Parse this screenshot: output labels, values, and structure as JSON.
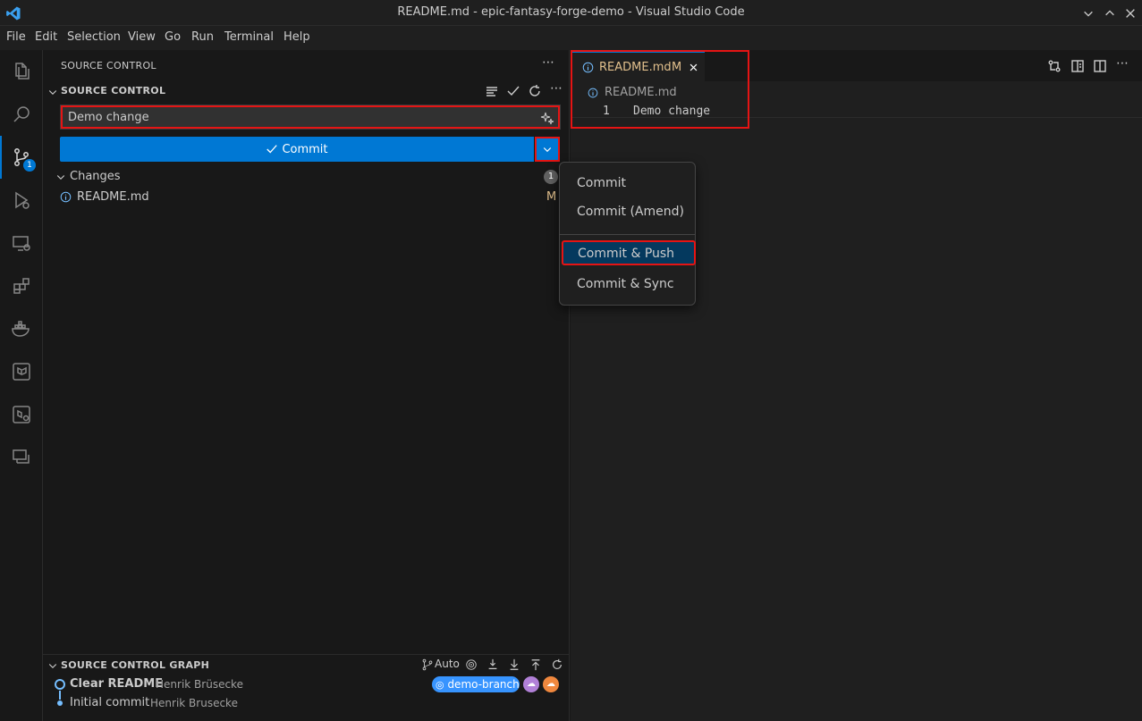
{
  "window": {
    "title": "README.md - epic-fantasy-forge-demo - Visual Studio Code"
  },
  "menubar": [
    "File",
    "Edit",
    "Selection",
    "View",
    "Go",
    "Run",
    "Terminal",
    "Help"
  ],
  "activitybar": {
    "scm_badge": "1"
  },
  "sidebar": {
    "header": "SOURCE CONTROL",
    "section_title": "SOURCE CONTROL",
    "commit_message": "Demo change",
    "commit_label": "Commit",
    "changes_label": "Changes",
    "changes_count": "1",
    "files": [
      {
        "name": "README.md",
        "status": "M"
      }
    ]
  },
  "graph": {
    "title": "SOURCE CONTROL GRAPH",
    "auto_label": "Auto",
    "commits": [
      {
        "message": "Clear README",
        "author": "Henrik Brüsecke"
      },
      {
        "message": "Initial commit",
        "author": "Henrik Brusecke"
      }
    ],
    "branch": "demo-branch"
  },
  "editor": {
    "tab_label": "README.md",
    "tab_status": "M",
    "breadcrumb": "README.md",
    "line_number": "1",
    "line_text": "Demo change"
  },
  "dropdown": {
    "items": [
      "Commit",
      "Commit (Amend)",
      "Commit & Push",
      "Commit & Sync"
    ]
  },
  "colors": {
    "accent": "#0078d4",
    "highlight": "#e51414",
    "modified": "#e2c08d"
  }
}
